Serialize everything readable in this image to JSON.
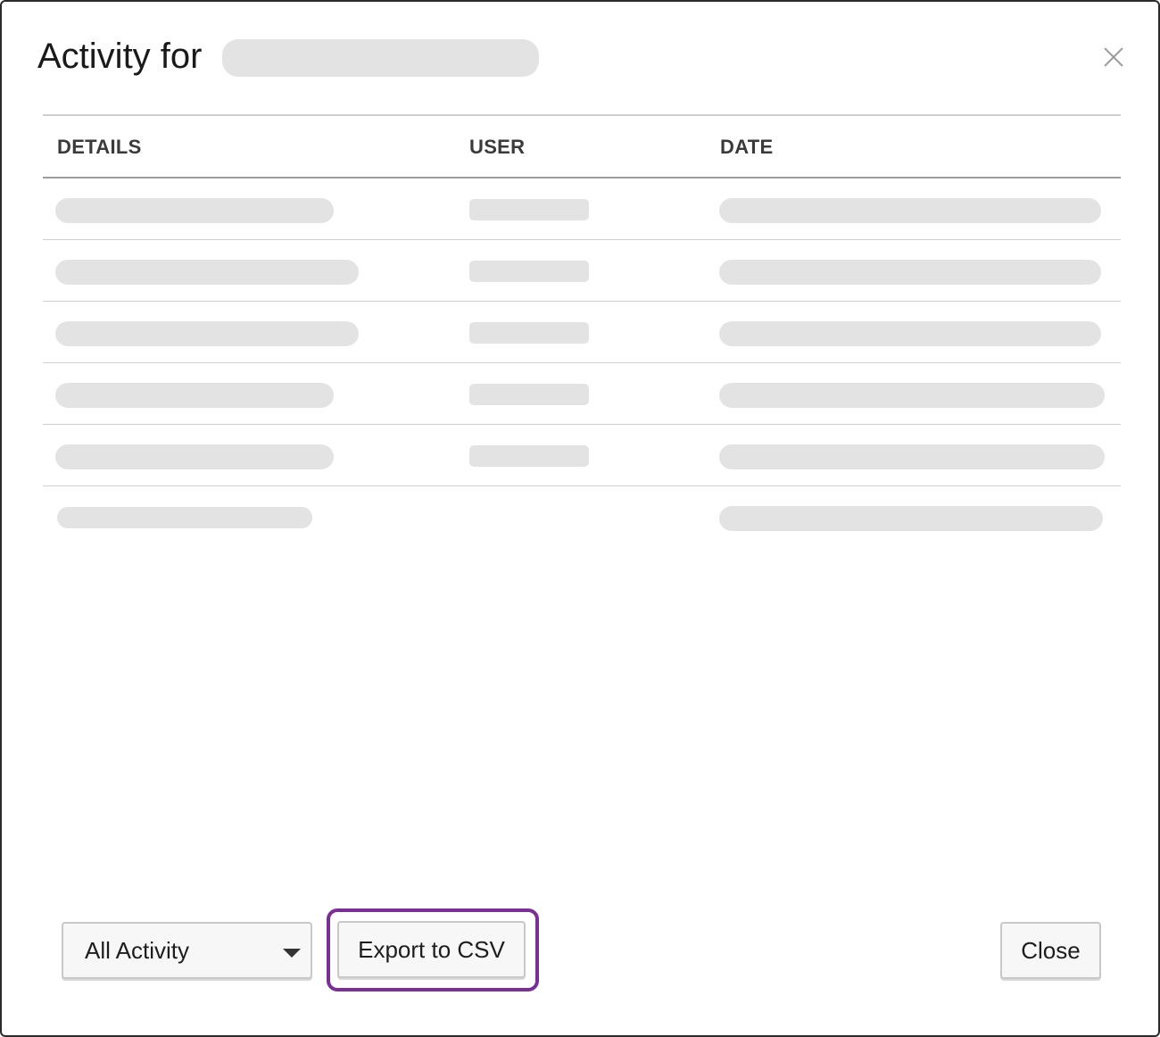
{
  "dialog": {
    "title": "Activity for",
    "title_name_redacted": true
  },
  "table": {
    "headers": {
      "details": "DETAILS",
      "user": "USER",
      "date": "DATE"
    },
    "rows": [
      {
        "details": "",
        "user": "",
        "date": ""
      },
      {
        "details": "",
        "user": "",
        "date": ""
      },
      {
        "details": "",
        "user": "",
        "date": ""
      },
      {
        "details": "",
        "user": "",
        "date": ""
      },
      {
        "details": "",
        "user": "",
        "date": ""
      },
      {
        "details": "",
        "user": "",
        "date": ""
      }
    ],
    "redacted_color": "#e3e3e3"
  },
  "footer": {
    "filter_select": {
      "selected": "All Activity"
    },
    "export_label": "Export to CSV",
    "close_label": "Close",
    "highlight_color": "#7a2f94"
  },
  "icons": {
    "close": "close-icon",
    "dropdown": "caret-down-icon"
  }
}
